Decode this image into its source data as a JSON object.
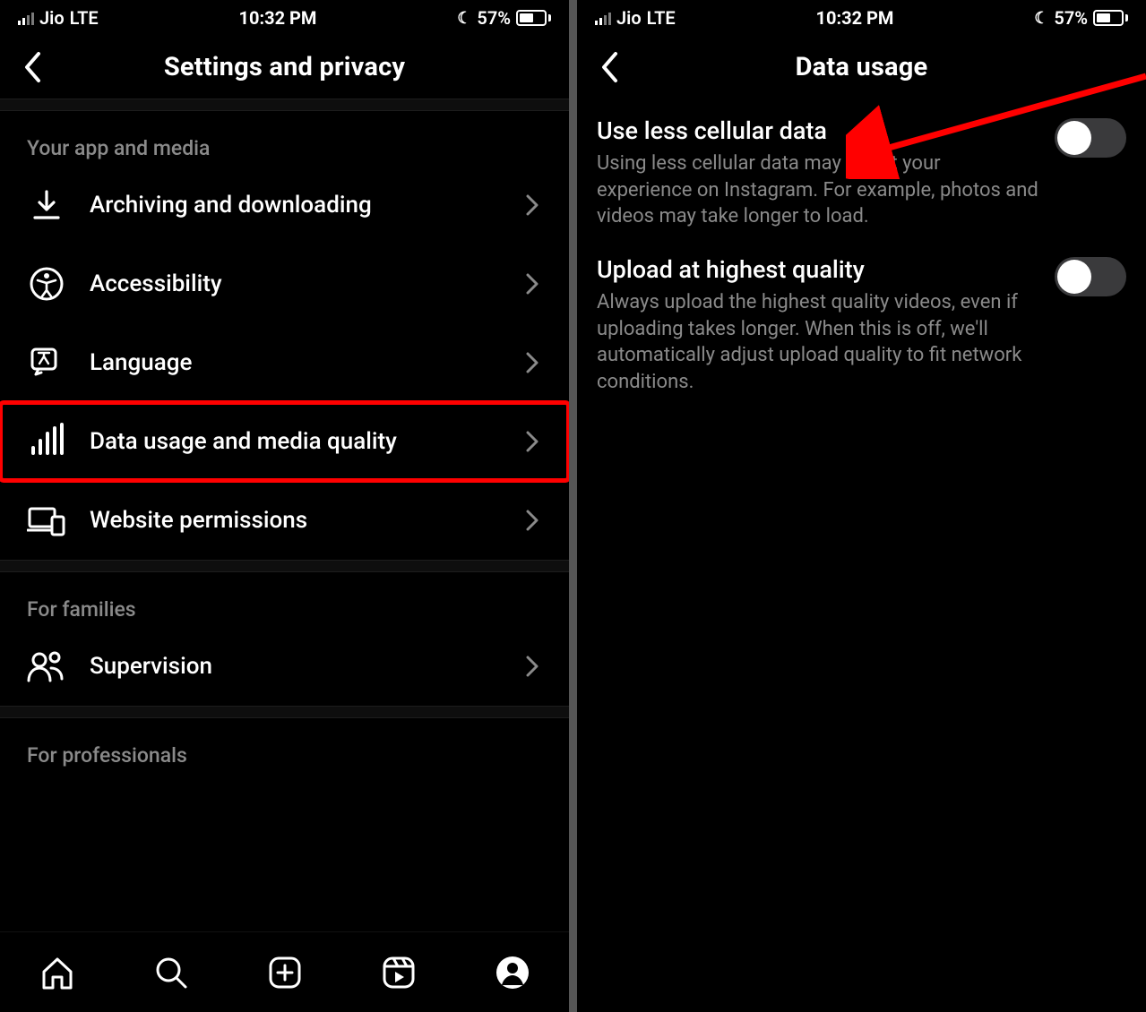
{
  "status": {
    "carrier": "Jio",
    "network": "LTE",
    "time": "10:32 PM",
    "battery_pct": "57%",
    "battery_fill_pct": 57
  },
  "screen1": {
    "title": "Settings and privacy",
    "section1_label": "Your app and media",
    "section2_label": "For families",
    "section3_label": "For professionals",
    "rows": {
      "archiving": "Archiving and downloading",
      "accessibility": "Accessibility",
      "language": "Language",
      "data_usage": "Data usage and media quality",
      "website_perm": "Website permissions",
      "supervision": "Supervision"
    }
  },
  "screen2": {
    "title": "Data usage",
    "settings": {
      "less_data": {
        "title": "Use less cellular data",
        "desc": "Using less cellular data may affect your experience on Instagram. For example, photos and videos may take longer to load."
      },
      "highest_quality": {
        "title": "Upload at highest quality",
        "desc": "Always upload the highest quality videos, even if uploading takes longer. When this is off, we'll automatically adjust upload quality to fit network conditions."
      }
    }
  }
}
